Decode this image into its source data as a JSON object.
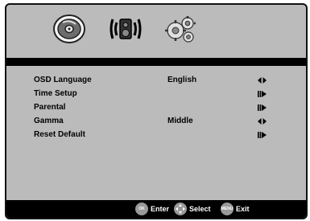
{
  "tabs": [
    {
      "name": "disc-setup",
      "icon": "disc-icon"
    },
    {
      "name": "audio-setup",
      "icon": "speaker-icon"
    },
    {
      "name": "preferences",
      "icon": "gears-icon"
    }
  ],
  "menu": {
    "items": [
      {
        "label": "OSD Language",
        "value": "English",
        "indicator": "left-right-arrows"
      },
      {
        "label": "Time Setup",
        "value": "",
        "indicator": "submenu-arrow"
      },
      {
        "label": "Parental",
        "value": "",
        "indicator": "submenu-arrow"
      },
      {
        "label": "Gamma",
        "value": "Middle",
        "indicator": "left-right-arrows"
      },
      {
        "label": "Reset Default",
        "value": "",
        "indicator": "submenu-arrow"
      }
    ]
  },
  "footer": {
    "ok_button": "OK",
    "enter_label": "Enter",
    "select_label": "Select",
    "exit_button": "MENU",
    "exit_label": "Exit"
  }
}
